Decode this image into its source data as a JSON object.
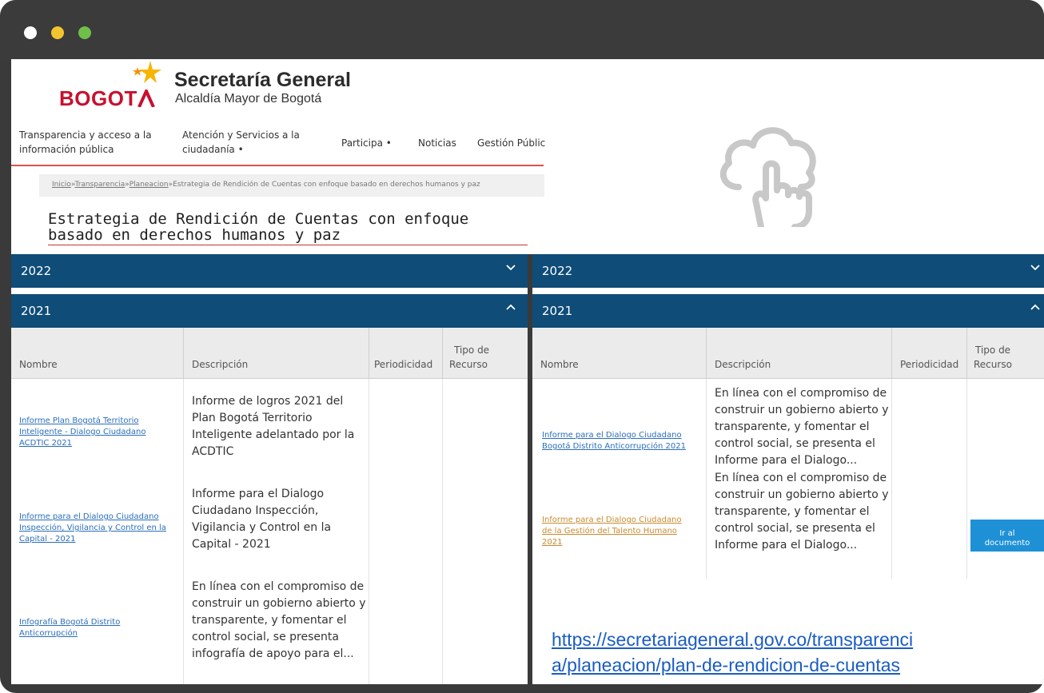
{
  "window": {
    "dots": [
      "#ffffff",
      "#f4c430",
      "#6fbf4a"
    ]
  },
  "header": {
    "logo_text": "BOGOT",
    "title": "Secretaría General",
    "subtitle": "Alcaldía Mayor de Bogotá"
  },
  "nav": {
    "items": [
      {
        "label_l1": "Transparencia y acceso a la",
        "label_l2": "información pública"
      },
      {
        "label_l1": "Atención y Servicios a la",
        "label_l2": "ciudadanía  •"
      },
      {
        "label": "Participa  •"
      },
      {
        "label": "Noticias"
      },
      {
        "label": "Gestión Públic"
      }
    ]
  },
  "breadcrumb": {
    "inicio": "Inicio",
    "sep": "»",
    "transparencia": "Transparencia",
    "planeacion": "Planeacion",
    "current": "Estrategia de Rendición de Cuentas con enfoque basado en derechos humanos y paz"
  },
  "page_title_l1": "Estrategia de Rendición de Cuentas con enfoque",
  "page_title_l2": "basado en derechos humanos y paz",
  "left": {
    "acc_2022": "2022",
    "acc_2021": "2021",
    "headers": {
      "nombre": "Nombre",
      "descripcion": "Descripción",
      "periodicidad": "Periodicidad",
      "tipo_l1": "Tipo de",
      "tipo_l2": "Recurso"
    },
    "rows": [
      {
        "name": [
          "Informe Plan Bogotá Territorio",
          "Inteligente - Dialogo Ciudadano",
          "ACDTIC 2021"
        ],
        "desc": [
          "Informe de logros 2021 del",
          "Plan Bogotá Territorio",
          "Inteligente adelantado por la",
          "ACDTIC"
        ]
      },
      {
        "name": [
          "Informe para el Dialogo Ciudadano",
          "Inspección, Vigilancia y Control en la",
          "Capital - 2021"
        ],
        "desc": [
          "Informe para el Dialogo",
          "Ciudadano Inspección,",
          "Vigilancia y Control en la",
          "Capital - 2021"
        ]
      },
      {
        "name": [
          "Infografía Bogotá Distrito",
          "Anticorrupción"
        ],
        "desc": [
          "En línea con el compromiso de",
          "construir un gobierno abierto y",
          "transparente, y fomentar el",
          "control social, se presenta",
          "infografía de apoyo para el..."
        ]
      }
    ]
  },
  "right": {
    "acc_2022": "2022",
    "acc_2021": "2021",
    "headers": {
      "nombre": "Nombre",
      "descripcion": "Descripción",
      "periodicidad": "Periodicidad",
      "tipo_l1": "Tipo de",
      "tipo_l2": "Recurso"
    },
    "rows": [
      {
        "name": [
          "Informe para el Dialogo Ciudadano",
          "Bogotá Distrito Anticorrupción 2021"
        ],
        "desc": [
          "En línea con el compromiso de",
          "construir un gobierno abierto y",
          "transparente, y fomentar el",
          "control social, se presenta el",
          "Informe para el Dialogo..."
        ]
      },
      {
        "name": [
          "Informe para el Dialogo Ciudadano",
          "de la Gestión del Talento Humano",
          "2021"
        ],
        "desc": [
          "En línea con el compromiso de",
          "construir un gobierno abierto y",
          "transparente, y fomentar el",
          "control social, se presenta el",
          "Informe para el Dialogo..."
        ],
        "button_l1": "Ir al",
        "button_l2": "documento"
      }
    ]
  },
  "url_l1": "https://secretariageneral.gov.co/transparenci",
  "url_l2": "a/planeacion/plan-de-rendicion-de-cuentas",
  "icons": {
    "cloud": "cloud-touch-icon",
    "chevron_down": "chevron-down-icon",
    "chevron_up": "chevron-up-icon"
  }
}
